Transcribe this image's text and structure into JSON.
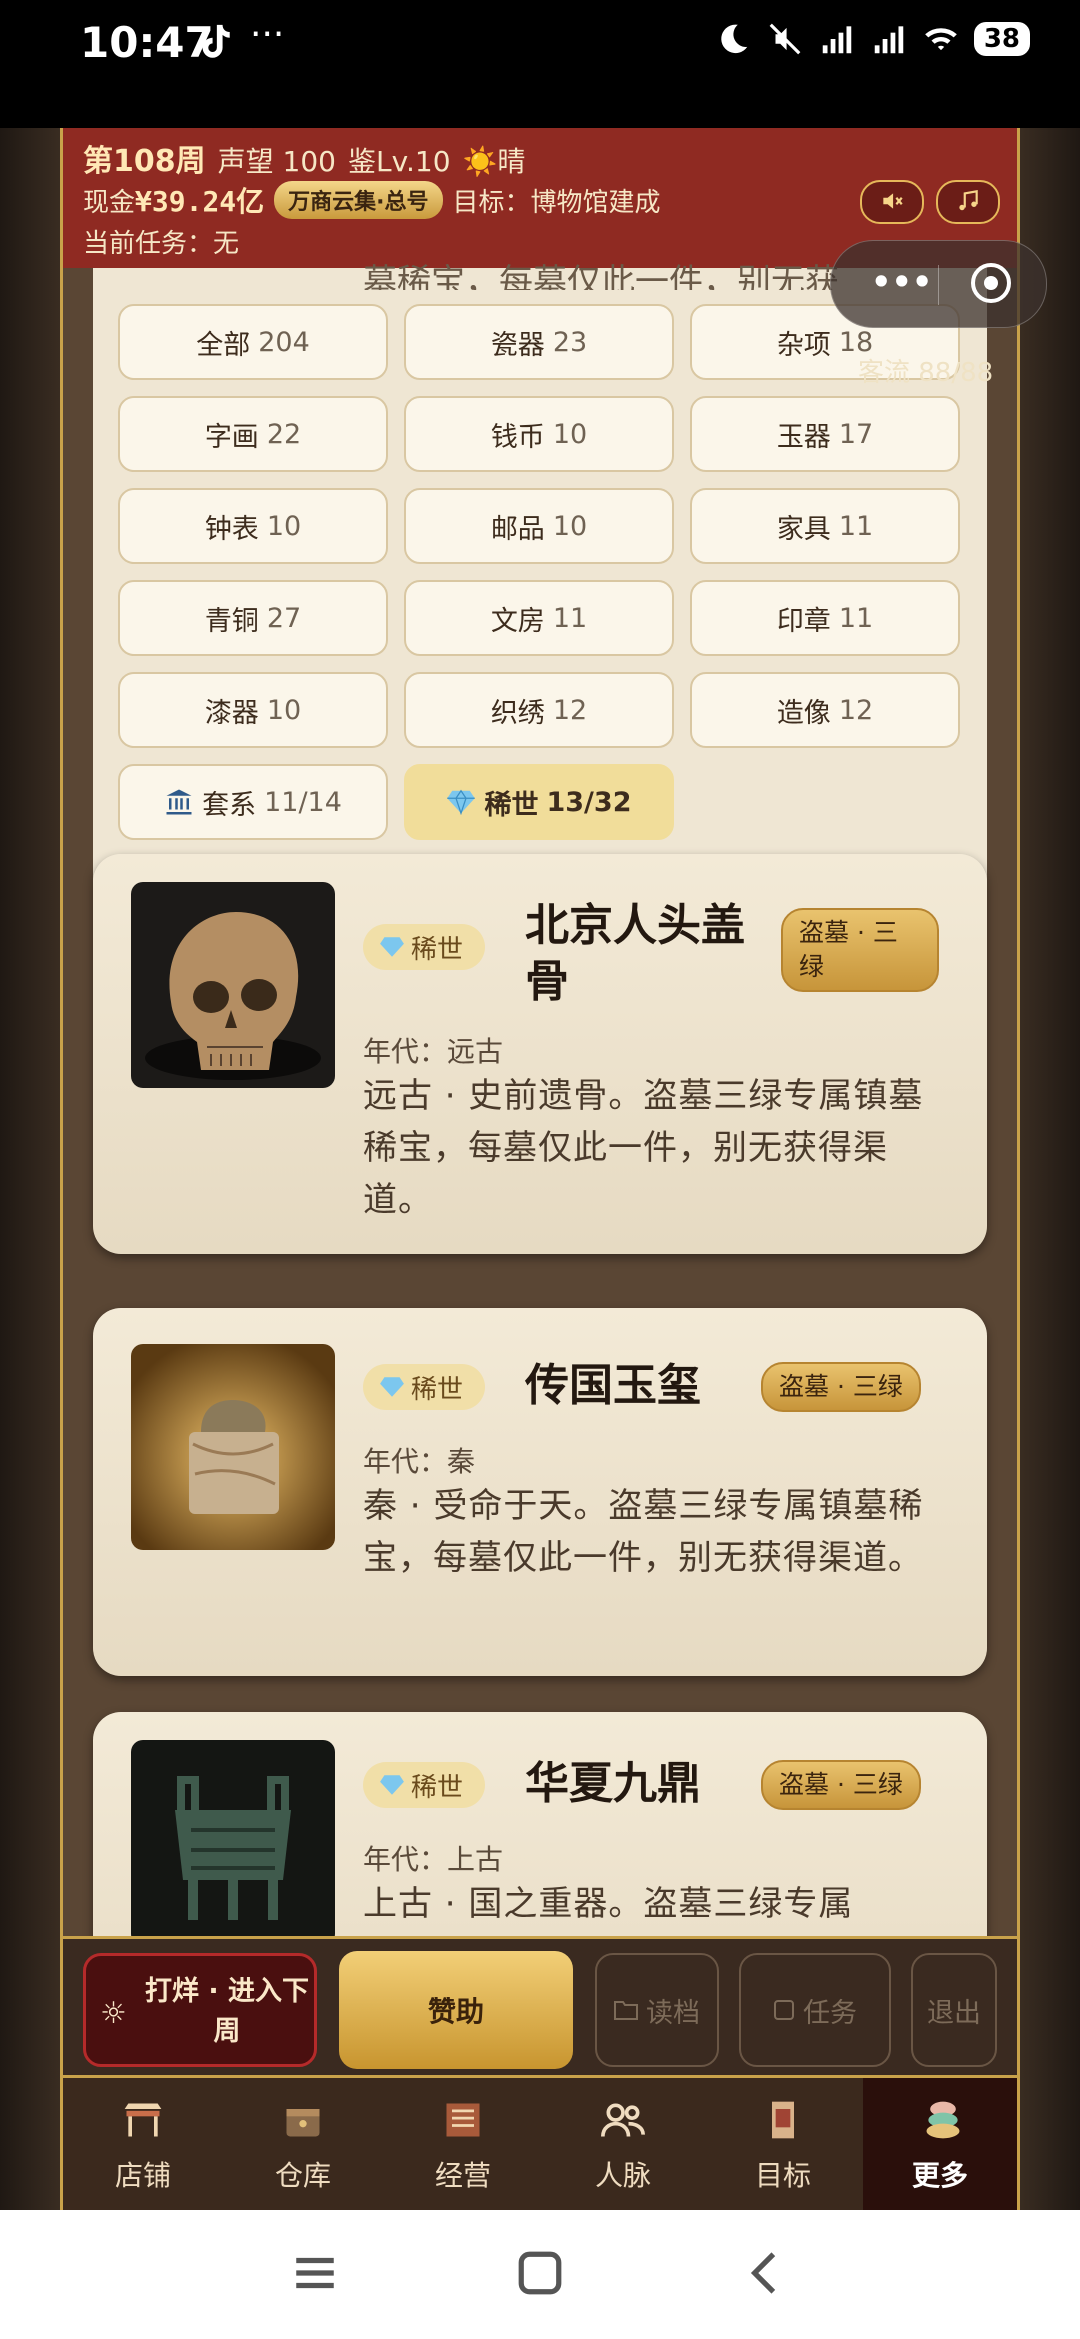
{
  "status": {
    "time": "10:47",
    "dots": "···",
    "battery": "38"
  },
  "header": {
    "week": "第108周",
    "reputation": "声望 100",
    "level": "鉴Lv.10",
    "weather": "☀️晴",
    "cash_label": "现金",
    "cash_value": "¥39.24亿",
    "company_pill": "万商云集·总号",
    "goal": "目标：博物馆建成",
    "task": "当前任务：无",
    "traffic": "客流 88/88"
  },
  "panel": {
    "peek_text": "墓稀宝，每墓仅此一件，别无获",
    "chips": [
      {
        "label": "全部",
        "count": "204"
      },
      {
        "label": "瓷器",
        "count": "23"
      },
      {
        "label": "杂项",
        "count": "18"
      },
      {
        "label": "字画",
        "count": "22"
      },
      {
        "label": "钱币",
        "count": "10"
      },
      {
        "label": "玉器",
        "count": "17"
      },
      {
        "label": "钟表",
        "count": "10"
      },
      {
        "label": "邮品",
        "count": "10"
      },
      {
        "label": "家具",
        "count": "11"
      },
      {
        "label": "青铜",
        "count": "27"
      },
      {
        "label": "文房",
        "count": "11"
      },
      {
        "label": "印章",
        "count": "11"
      },
      {
        "label": "漆器",
        "count": "10"
      },
      {
        "label": "织绣",
        "count": "12"
      },
      {
        "label": "造像",
        "count": "12"
      },
      {
        "label": "套系",
        "count": "11/14"
      },
      {
        "label": "稀世",
        "count": "13/32"
      }
    ]
  },
  "items": [
    {
      "rarity": "稀世",
      "name_line1": "北京人头盖",
      "name_line2": "骨",
      "source_line1": "盗墓 · 三",
      "source_line2": "绿",
      "era": "年代：远古",
      "desc": "远古 · 史前遗骨。盗墓三绿专属镇墓稀宝，每墓仅此一件，别无获得渠道。"
    },
    {
      "rarity": "稀世",
      "name": "传国玉玺",
      "source": "盗墓 · 三绿",
      "era": "年代：秦",
      "desc": "秦 · 受命于天。盗墓三绿专属镇墓稀宝，每墓仅此一件，别无获得渠道。"
    },
    {
      "rarity": "稀世",
      "name": "华夏九鼎",
      "source": "盗墓 · 三绿",
      "era": "年代：上古",
      "desc": "上古 · 国之重器。盗墓三绿专属"
    }
  ],
  "actions": {
    "next_week": "打烊 · 进入下周",
    "sponsor": "赞助",
    "load": "读档",
    "tasks": "任务",
    "exit": "退出"
  },
  "nav": {
    "shop": "店铺",
    "warehouse": "仓库",
    "operate": "经营",
    "contacts": "人脉",
    "goal": "目标",
    "more": "更多"
  },
  "colors": {
    "header_red": "#8f2a22",
    "gold": "#c9a24a",
    "card": "#f3ead7",
    "active_chip": "#f1dd9a"
  }
}
